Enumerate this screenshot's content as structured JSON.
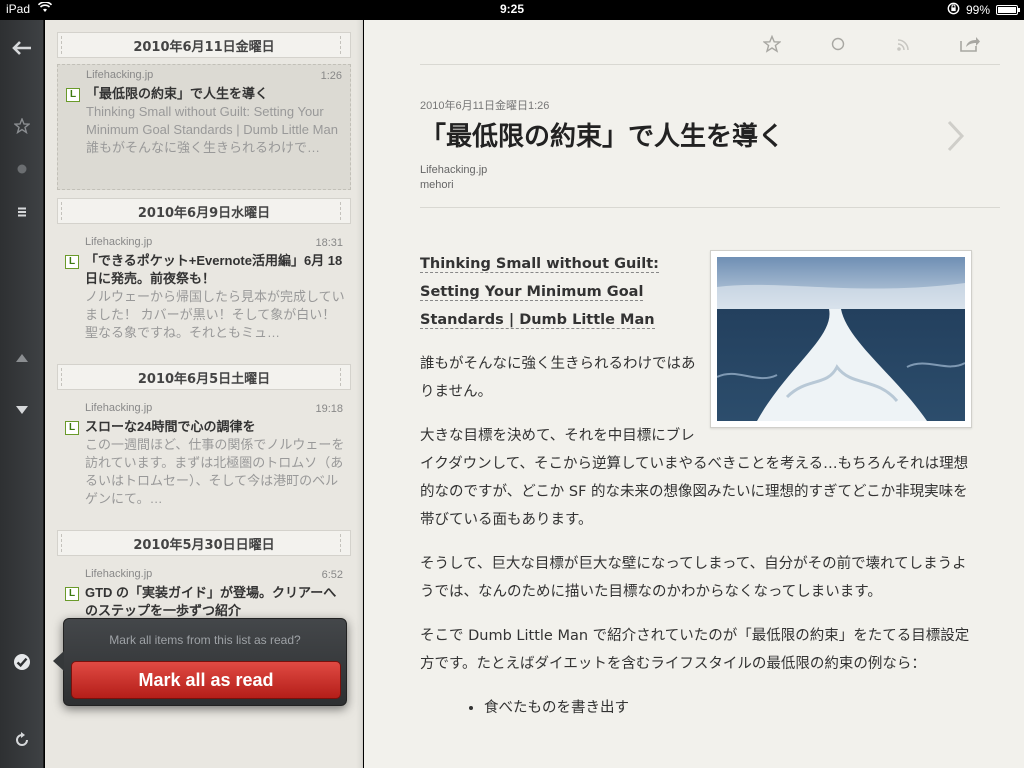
{
  "statusbar": {
    "device": "iPad",
    "time": "9:25",
    "battery": "99%"
  },
  "list": {
    "groups": [
      {
        "date": "2010年6月11日金曜日",
        "items": [
          {
            "source": "Lifehacking.jp",
            "time": "1:26",
            "title": "「最低限の約束」で人生を導く",
            "snippet": "Thinking Small without Guilt: Setting Your Minimum Goal Standards | Dumb Little Man 誰もがそんなに強く生きられるわけで…"
          }
        ]
      },
      {
        "date": "2010年6月9日水曜日",
        "items": [
          {
            "source": "Lifehacking.jp",
            "time": "18:31",
            "title": "「できるポケット+Evernote活用編」6月 18 日に発売。前夜祭も！",
            "snippet": "ノルウェーから帰国したら見本が完成していました！ カバーが黒い！そして象が白い！ 聖なる象ですね。それともミュ…"
          }
        ]
      },
      {
        "date": "2010年6月5日土曜日",
        "items": [
          {
            "source": "Lifehacking.jp",
            "time": "19:18",
            "title": "スローな24時間で心の調律を",
            "snippet": "この一週間ほど、仕事の関係でノルウェーを訪れています。まずは北極圏のトロムソ（あるいはトロムセー）、そして今は港町のベルゲンにて。…"
          }
        ]
      },
      {
        "date": "2010年5月30日日曜日",
        "items": [
          {
            "source": "Lifehacking.jp",
            "time": "6:52",
            "title": "GTD の「実装ガイド」が登場。クリアーへのステップを一歩ずつ紹介",
            "snippet": ""
          }
        ]
      }
    ]
  },
  "popover": {
    "question": "Mark all items from this list as read?",
    "button": "Mark all as read"
  },
  "article": {
    "date": "2010年6月11日金曜日1:26",
    "title": "「最低限の約束」で人生を導く",
    "source": "Lifehacking.jp",
    "author": "mehori",
    "link_text": "Thinking Small without Guilt: Setting Your Minimum Goal Standards | Dumb Little Man",
    "paragraphs": [
      "誰もがそんなに強く生きられるわけではありません。",
      "大きな目標を決めて、それを中目標にブレイクダウンして、そこから逆算していまやるべきことを考える…もちろんそれは理想的なのですが、どこか SF 的な未来の想像図みたいに理想的すぎてどこか非現実味を帯びている面もあります。",
      "そうして、巨大な目標が巨大な壁になってしまって、自分がその前で壊れてしまうようでは、なんのために描いた目標なのかわからなくなってしまいます。",
      "そこで Dumb Little Man で紹介されていたのが「最低限の約束」をたてる目標設定方です。たとえばダイエットを含むライフスタイルの最低限の約束の例なら："
    ],
    "bullets": [
      "食べたものを書き出す"
    ]
  },
  "battery_level": 0.99
}
